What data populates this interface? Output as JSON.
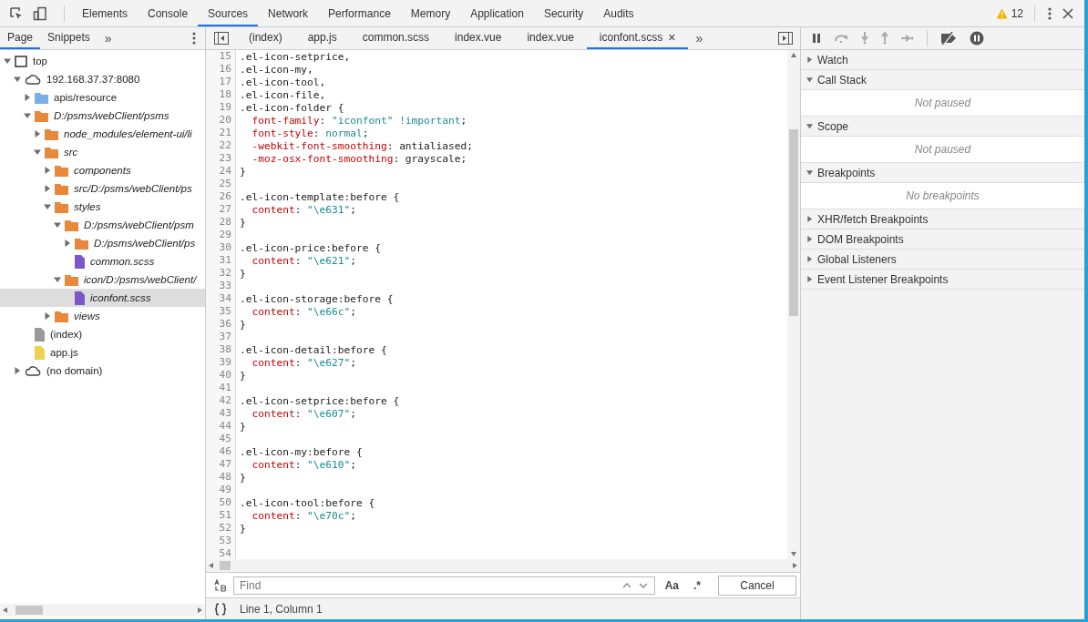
{
  "toolbar": {
    "tabs": [
      {
        "label": "Elements",
        "selected": false
      },
      {
        "label": "Console",
        "selected": false
      },
      {
        "label": "Sources",
        "selected": true
      },
      {
        "label": "Network",
        "selected": false
      },
      {
        "label": "Performance",
        "selected": false
      },
      {
        "label": "Memory",
        "selected": false
      },
      {
        "label": "Application",
        "selected": false
      },
      {
        "label": "Security",
        "selected": false
      },
      {
        "label": "Audits",
        "selected": false
      }
    ],
    "warnings": "12"
  },
  "navigator": {
    "tabs": [
      {
        "label": "Page",
        "selected": true
      },
      {
        "label": "Snippets",
        "selected": false
      }
    ],
    "more": "»",
    "tree": [
      {
        "label": "top",
        "kind": "frame",
        "expanded": true,
        "children": [
          {
            "label": "192.168.37.37:8080",
            "kind": "domain",
            "expanded": true,
            "children": [
              {
                "label": "apis/resource",
                "kind": "folder",
                "color": "#7aaee8",
                "mapped": false,
                "expanded": false
              },
              {
                "label": "D:/psms/webClient/psms",
                "kind": "folder",
                "color": "#e8883a",
                "mapped": true,
                "expanded": true,
                "children": [
                  {
                    "label": "node_modules/element-ui/li",
                    "kind": "folder",
                    "color": "#e8883a",
                    "mapped": true,
                    "expanded": false
                  },
                  {
                    "label": "src",
                    "kind": "folder",
                    "color": "#e8883a",
                    "mapped": true,
                    "expanded": true,
                    "children": [
                      {
                        "label": "components",
                        "kind": "folder",
                        "color": "#e8883a",
                        "mapped": true,
                        "expanded": false
                      },
                      {
                        "label": "src/D:/psms/webClient/ps",
                        "kind": "folder",
                        "color": "#e8883a",
                        "mapped": true,
                        "expanded": false
                      },
                      {
                        "label": "styles",
                        "kind": "folder",
                        "color": "#e8883a",
                        "mapped": true,
                        "expanded": true,
                        "children": [
                          {
                            "label": "D:/psms/webClient/psm",
                            "kind": "folder",
                            "color": "#e8883a",
                            "mapped": true,
                            "expanded": true,
                            "children": [
                              {
                                "label": "D:/psms/webClient/ps",
                                "kind": "folder",
                                "color": "#e8883a",
                                "mapped": true,
                                "expanded": false
                              },
                              {
                                "label": "common.scss",
                                "kind": "file",
                                "color": "#7b57c8",
                                "mapped": true,
                                "selected": false
                              }
                            ]
                          },
                          {
                            "label": "icon/D:/psms/webClient/",
                            "kind": "folder",
                            "color": "#e8883a",
                            "mapped": true,
                            "expanded": true,
                            "children": [
                              {
                                "label": "iconfont.scss",
                                "kind": "file",
                                "color": "#7b57c8",
                                "mapped": true,
                                "selected": true
                              }
                            ]
                          }
                        ]
                      },
                      {
                        "label": "views",
                        "kind": "folder",
                        "color": "#e8883a",
                        "mapped": true,
                        "expanded": false
                      }
                    ]
                  }
                ]
              },
              {
                "label": "(index)",
                "kind": "file",
                "color": "#9a9a9a",
                "mapped": false,
                "selected": false
              },
              {
                "label": "app.js",
                "kind": "file",
                "color": "#f0d050",
                "mapped": false,
                "selected": false
              }
            ]
          },
          {
            "label": "(no domain)",
            "kind": "domain",
            "expanded": false
          }
        ]
      }
    ]
  },
  "editor": {
    "tabs": [
      {
        "label": "(index)",
        "selected": false
      },
      {
        "label": "app.js",
        "selected": false
      },
      {
        "label": "common.scss",
        "selected": false
      },
      {
        "label": "index.vue",
        "selected": false
      },
      {
        "label": "index.vue",
        "selected": false
      },
      {
        "label": "iconfont.scss",
        "selected": true,
        "close": "×"
      }
    ],
    "more": "»",
    "lines": [
      {
        "number": "15",
        "tokens": [
          {
            "kind": "sel",
            "text": ".el-icon-setprice,"
          }
        ]
      },
      {
        "number": "16",
        "tokens": [
          {
            "kind": "sel",
            "text": ".el-icon-my,"
          }
        ]
      },
      {
        "number": "17",
        "tokens": [
          {
            "kind": "sel",
            "text": ".el-icon-tool,"
          }
        ]
      },
      {
        "number": "18",
        "tokens": [
          {
            "kind": "sel",
            "text": ".el-icon-file,"
          }
        ]
      },
      {
        "number": "19",
        "tokens": [
          {
            "kind": "sel",
            "text": ".el-icon-folder {"
          }
        ]
      },
      {
        "number": "20",
        "tokens": [
          {
            "kind": "prop",
            "text": "  font-family"
          },
          {
            "kind": "plain",
            "text": ": "
          },
          {
            "kind": "str",
            "text": "\"iconfont\" !important"
          },
          {
            "kind": "plain",
            "text": ";"
          }
        ]
      },
      {
        "number": "21",
        "tokens": [
          {
            "kind": "prop",
            "text": "  font-style"
          },
          {
            "kind": "plain",
            "text": ": "
          },
          {
            "kind": "str",
            "text": "normal"
          },
          {
            "kind": "plain",
            "text": ";"
          }
        ]
      },
      {
        "number": "22",
        "tokens": [
          {
            "kind": "prop",
            "text": "  -webkit-font-smoothing"
          },
          {
            "kind": "plain",
            "text": ": antialiased;"
          }
        ]
      },
      {
        "number": "23",
        "tokens": [
          {
            "kind": "prop",
            "text": "  -moz-osx-font-smoothing"
          },
          {
            "kind": "plain",
            "text": ": grayscale;"
          }
        ]
      },
      {
        "number": "24",
        "tokens": [
          {
            "kind": "sel",
            "text": "}"
          }
        ]
      },
      {
        "number": "25"
      },
      {
        "number": "26",
        "tokens": [
          {
            "kind": "sel",
            "text": ".el-icon-template:before {"
          }
        ]
      },
      {
        "number": "27",
        "tokens": [
          {
            "kind": "prop",
            "text": "  content"
          },
          {
            "kind": "plain",
            "text": ": "
          },
          {
            "kind": "str",
            "text": "\"\\e631\""
          },
          {
            "kind": "plain",
            "text": ";"
          }
        ]
      },
      {
        "number": "28",
        "tokens": [
          {
            "kind": "sel",
            "text": "}"
          }
        ]
      },
      {
        "number": "29"
      },
      {
        "number": "30",
        "tokens": [
          {
            "kind": "sel",
            "text": ".el-icon-price:before {"
          }
        ]
      },
      {
        "number": "31",
        "tokens": [
          {
            "kind": "prop",
            "text": "  content"
          },
          {
            "kind": "plain",
            "text": ": "
          },
          {
            "kind": "str",
            "text": "\"\\e621\""
          },
          {
            "kind": "plain",
            "text": ";"
          }
        ]
      },
      {
        "number": "32",
        "tokens": [
          {
            "kind": "sel",
            "text": "}"
          }
        ]
      },
      {
        "number": "33"
      },
      {
        "number": "34",
        "tokens": [
          {
            "kind": "sel",
            "text": ".el-icon-storage:before {"
          }
        ]
      },
      {
        "number": "35",
        "tokens": [
          {
            "kind": "prop",
            "text": "  content"
          },
          {
            "kind": "plain",
            "text": ": "
          },
          {
            "kind": "str",
            "text": "\"\\e66c\""
          },
          {
            "kind": "plain",
            "text": ";"
          }
        ]
      },
      {
        "number": "36",
        "tokens": [
          {
            "kind": "sel",
            "text": "}"
          }
        ]
      },
      {
        "number": "37"
      },
      {
        "number": "38",
        "tokens": [
          {
            "kind": "sel",
            "text": ".el-icon-detail:before {"
          }
        ]
      },
      {
        "number": "39",
        "tokens": [
          {
            "kind": "prop",
            "text": "  content"
          },
          {
            "kind": "plain",
            "text": ": "
          },
          {
            "kind": "str",
            "text": "\"\\e627\""
          },
          {
            "kind": "plain",
            "text": ";"
          }
        ]
      },
      {
        "number": "40",
        "tokens": [
          {
            "kind": "sel",
            "text": "}"
          }
        ]
      },
      {
        "number": "41"
      },
      {
        "number": "42",
        "tokens": [
          {
            "kind": "sel",
            "text": ".el-icon-setprice:before {"
          }
        ]
      },
      {
        "number": "43",
        "tokens": [
          {
            "kind": "prop",
            "text": "  content"
          },
          {
            "kind": "plain",
            "text": ": "
          },
          {
            "kind": "str",
            "text": "\"\\e607\""
          },
          {
            "kind": "plain",
            "text": ";"
          }
        ]
      },
      {
        "number": "44",
        "tokens": [
          {
            "kind": "sel",
            "text": "}"
          }
        ]
      },
      {
        "number": "45"
      },
      {
        "number": "46",
        "tokens": [
          {
            "kind": "sel",
            "text": ".el-icon-my:before {"
          }
        ]
      },
      {
        "number": "47",
        "tokens": [
          {
            "kind": "prop",
            "text": "  content"
          },
          {
            "kind": "plain",
            "text": ": "
          },
          {
            "kind": "str",
            "text": "\"\\e610\""
          },
          {
            "kind": "plain",
            "text": ";"
          }
        ]
      },
      {
        "number": "48",
        "tokens": [
          {
            "kind": "sel",
            "text": "}"
          }
        ]
      },
      {
        "number": "49"
      },
      {
        "number": "50",
        "tokens": [
          {
            "kind": "sel",
            "text": ".el-icon-tool:before {"
          }
        ]
      },
      {
        "number": "51",
        "tokens": [
          {
            "kind": "prop",
            "text": "  content"
          },
          {
            "kind": "plain",
            "text": ": "
          },
          {
            "kind": "str",
            "text": "\"\\e70c\""
          },
          {
            "kind": "plain",
            "text": ";"
          }
        ]
      },
      {
        "number": "52",
        "tokens": [
          {
            "kind": "sel",
            "text": "}"
          }
        ]
      },
      {
        "number": "53"
      },
      {
        "number": "54"
      }
    ],
    "find": {
      "placeholder": "Find",
      "match_case": "Aa",
      "regex": ".*",
      "cancel": "Cancel"
    },
    "status": "Line 1, Column 1"
  },
  "debugger": {
    "sections": [
      {
        "title": "Watch",
        "expanded": false
      },
      {
        "title": "Call Stack",
        "expanded": true,
        "message": "Not paused"
      },
      {
        "title": "Scope",
        "expanded": true,
        "message": "Not paused"
      },
      {
        "title": "Breakpoints",
        "expanded": true,
        "message": "No breakpoints"
      },
      {
        "title": "XHR/fetch Breakpoints",
        "expanded": false
      },
      {
        "title": "DOM Breakpoints",
        "expanded": false
      },
      {
        "title": "Global Listeners",
        "expanded": false
      },
      {
        "title": "Event Listener Breakpoints",
        "expanded": false
      }
    ]
  }
}
